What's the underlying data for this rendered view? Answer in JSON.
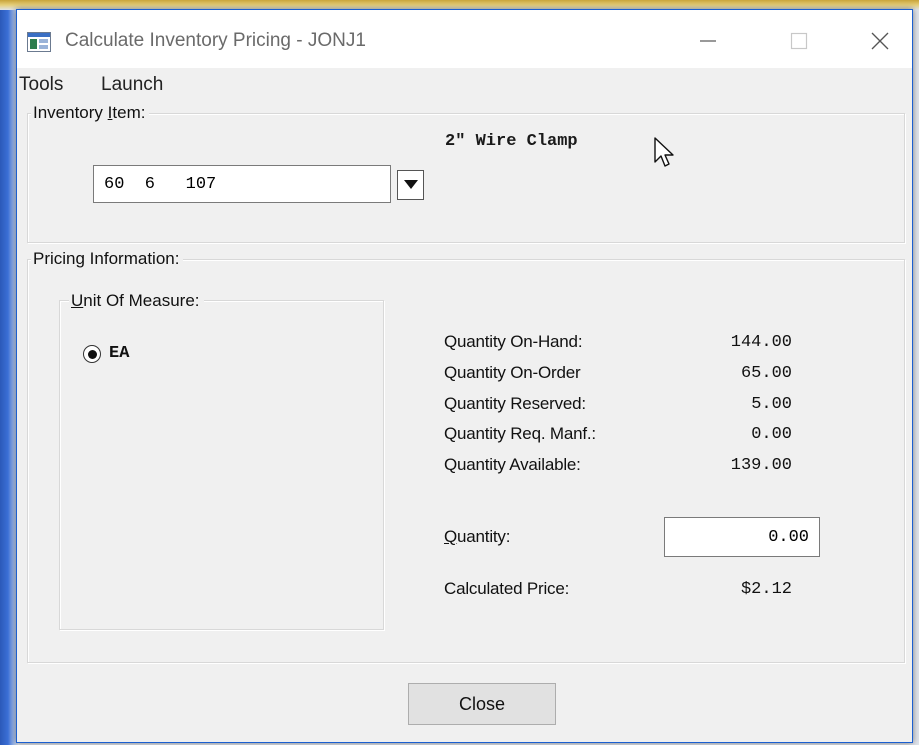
{
  "window": {
    "title": "Calculate Inventory Pricing - JONJ1",
    "minimize_glyph": "—",
    "maximize_glyph": "☐",
    "close_glyph": "✕"
  },
  "menu": {
    "tools": "Tools",
    "launch": "Launch"
  },
  "inventory_item": {
    "group_label_pre": "Inventory ",
    "group_label_mnemonic": "I",
    "group_label_post": "tem:",
    "item_number": "60  6   107",
    "description": "2\" Wire Clamp"
  },
  "pricing": {
    "group_label": "Pricing Information:",
    "uom_group_label_mnemonic": "U",
    "uom_group_label_post": "nit Of Measure:",
    "uom_option": "EA",
    "uom_selected": true,
    "stats": [
      {
        "label": "Quantity On-Hand:",
        "value": "144.00"
      },
      {
        "label": "Quantity On-Order",
        "value": "65.00"
      },
      {
        "label": "Quantity Reserved:",
        "value": "5.00"
      },
      {
        "label": "Quantity Req. Manf.:",
        "value": "0.00"
      },
      {
        "label": "Quantity Available:",
        "value": "139.00"
      }
    ],
    "quantity_label_mnemonic": "Q",
    "quantity_label_post": "uantity:",
    "quantity_value": "0.00",
    "calc_price_label": "Calculated Price:",
    "calc_price_value": "$2.12"
  },
  "buttons": {
    "close": "Close"
  },
  "colors": {
    "window_border": "#1b5fd0",
    "title_text": "#6a6a6a",
    "background": "#f0f0f0"
  },
  "icons": [
    "app-window-icon",
    "minimize-icon",
    "maximize-icon",
    "close-icon",
    "dropdown-arrow-icon",
    "mouse-pointer-icon"
  ]
}
